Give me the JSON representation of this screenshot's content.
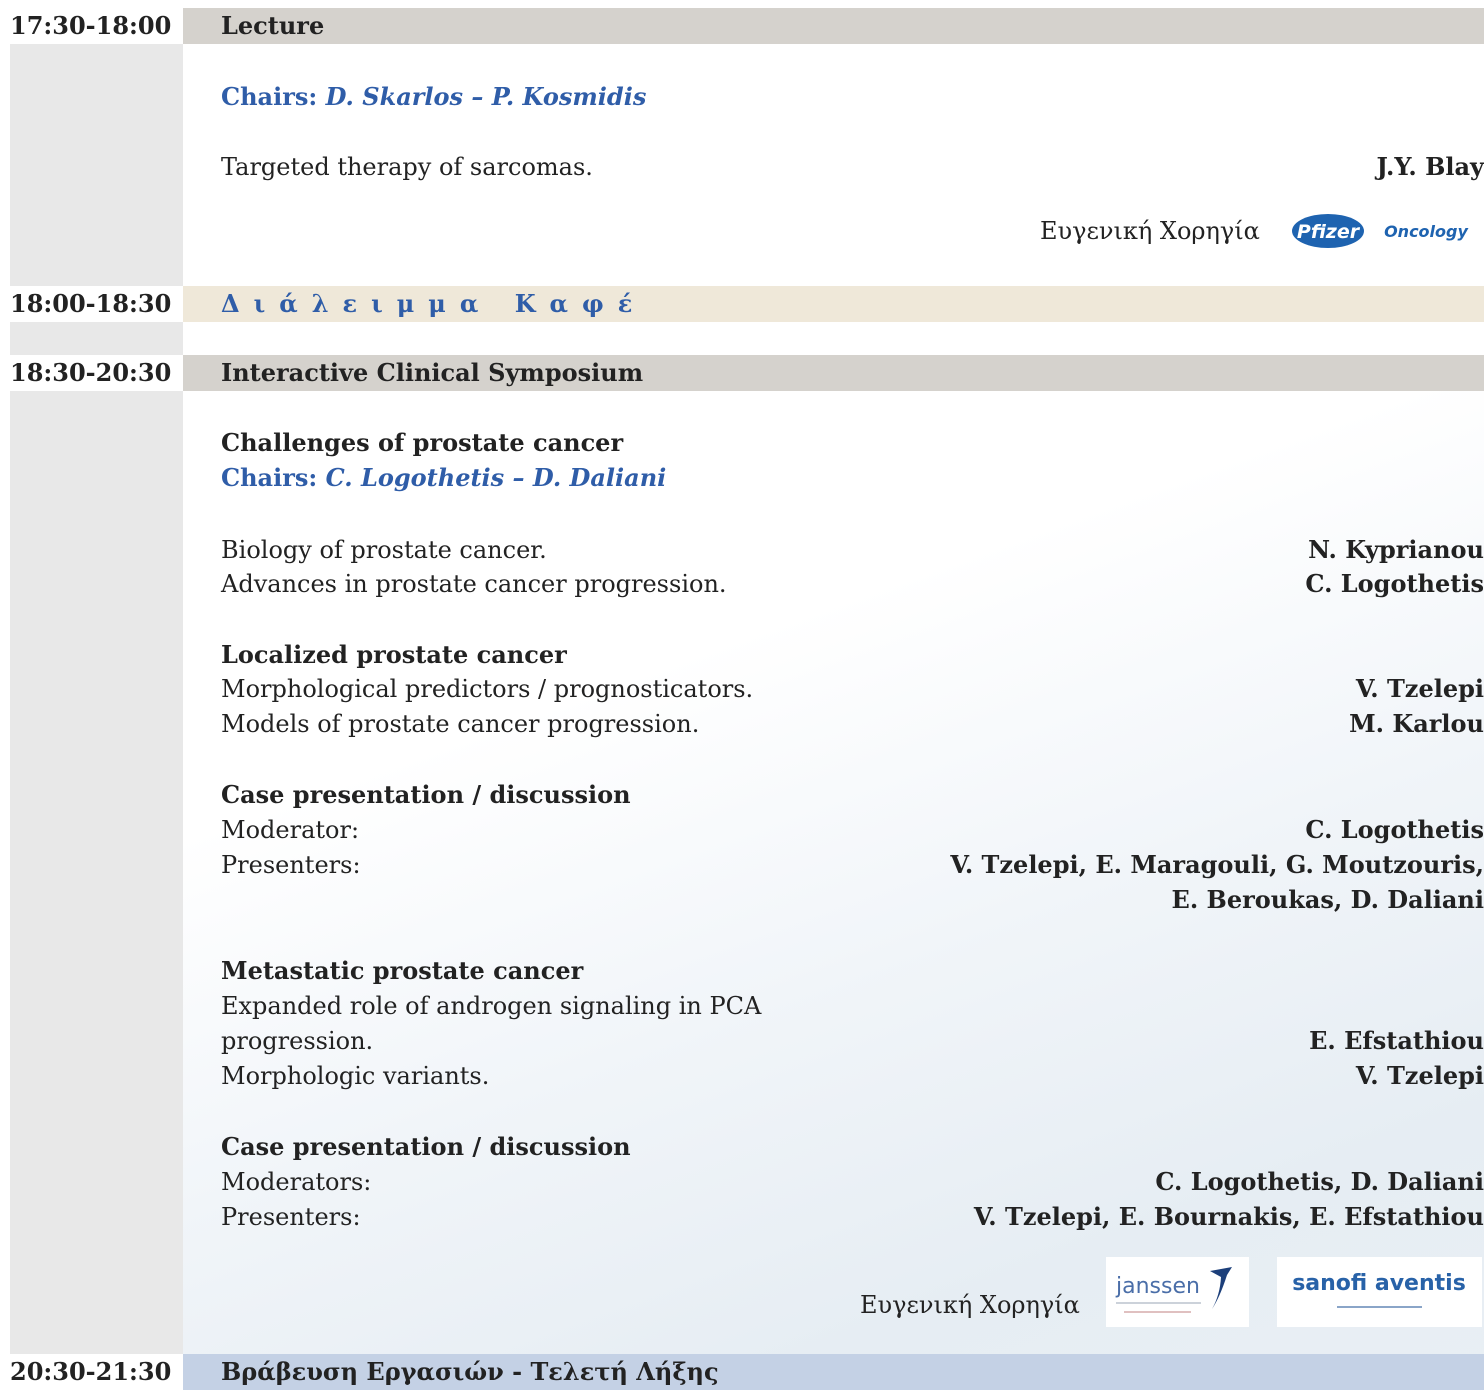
{
  "sessions": {
    "lecture": {
      "time": "17:30-18:00",
      "title": "Lecture"
    },
    "coffee": {
      "time": "18:00-18:30",
      "title": "Διάλειμμα Καφέ"
    },
    "symposium": {
      "time": "18:30-20:30",
      "title": "Interactive Clinical Symposium"
    },
    "awards": {
      "time": "20:30-21:30",
      "title": "Βράβευση Εργασιών - Τελετή Λήξης"
    }
  },
  "lecture": {
    "chairs_label": "Chairs:",
    "chairs_names": "D. Skarlos – P. Kosmidis",
    "talk": {
      "title": "Targeted therapy of sarcomas.",
      "speaker": "J.Y. Blay"
    },
    "sponsor_label": "Ευγενική Χορηγία",
    "sponsor_logo_text": "Pfizer",
    "sponsor_logo_sub": "Oncology"
  },
  "symposium": {
    "heading": "Challenges of prostate cancer",
    "chairs_label": "Chairs:",
    "chairs_names": "C. Logothetis – D. Daliani",
    "intro": [
      {
        "title": "Biology of prostate cancer.",
        "speaker": "N. Kyprianou"
      },
      {
        "title": "Advances in prostate cancer progression.",
        "speaker": "C. Logothetis"
      }
    ],
    "localized": {
      "heading": "Localized prostate cancer",
      "talks": [
        {
          "title": "Morphological predictors / prognosticators.",
          "speaker": "V. Tzelepi"
        },
        {
          "title": "Models of prostate cancer progression.",
          "speaker": "M. Karlou"
        }
      ]
    },
    "case1": {
      "heading": "Case presentation / discussion",
      "moderator_label": "Moderator:",
      "moderator": "C. Logothetis",
      "presenters_label": "Presenters:",
      "presenters_line1": "V. Tzelepi, E. Maragouli, G. Moutzouris,",
      "presenters_line2": "E. Beroukas, D. Daliani"
    },
    "metastatic": {
      "heading": "Metastatic prostate cancer",
      "talk1_line1": "Expanded role of androgen signaling in PCA",
      "talk1_line2": "progression.",
      "talk1_speaker": "E. Efstathiou",
      "talk2_title": "Morphologic variants.",
      "talk2_speaker": "V. Tzelepi"
    },
    "case2": {
      "heading": "Case presentation / discussion",
      "moderators_label": "Moderators:",
      "moderators": "C. Logothetis, D. Daliani",
      "presenters_label": "Presenters:",
      "presenters": "V. Tzelepi, E. Bournakis, E. Efstathiou"
    },
    "sponsor_label": "Ευγενική Χορηγία",
    "sponsor1_logo_text": "janssen",
    "sponsor2_logo_text": "sanofi aventis"
  },
  "colors": {
    "chairs_blue": "#2f5da8",
    "band_gray": "#d5d2cd",
    "band_beige": "#efe8d9",
    "band_blue": "#c4d1e5",
    "gutter_gray": "#e8e8e8",
    "pfizer_blue": "#1e63b0",
    "sanofi_blue": "#2862a8"
  }
}
